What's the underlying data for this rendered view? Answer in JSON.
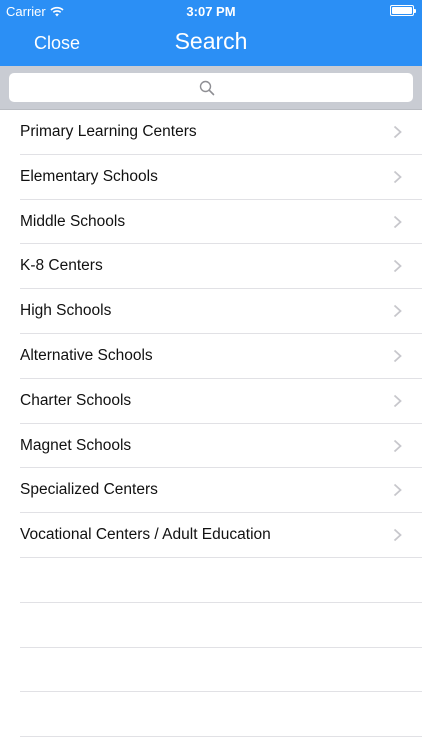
{
  "status_bar": {
    "carrier": "Carrier",
    "time": "3:07 PM"
  },
  "nav": {
    "close_label": "Close",
    "title": "Search"
  },
  "search": {
    "placeholder": ""
  },
  "categories": [
    {
      "label": "Primary Learning Centers"
    },
    {
      "label": "Elementary Schools"
    },
    {
      "label": "Middle Schools"
    },
    {
      "label": "K-8 Centers"
    },
    {
      "label": "High Schools"
    },
    {
      "label": "Alternative Schools"
    },
    {
      "label": "Charter Schools"
    },
    {
      "label": "Magnet Schools"
    },
    {
      "label": "Specialized Centers"
    },
    {
      "label": "Vocational Centers / Adult Education"
    }
  ],
  "colors": {
    "accent": "#2b8ff5",
    "search_bar_bg": "#c9ccd3",
    "separator": "#e1e1e5",
    "chevron": "#c7c7cc"
  },
  "icons": {
    "search": "search-icon",
    "chevron": "chevron-right-icon",
    "wifi": "wifi-icon",
    "battery": "battery-icon"
  }
}
